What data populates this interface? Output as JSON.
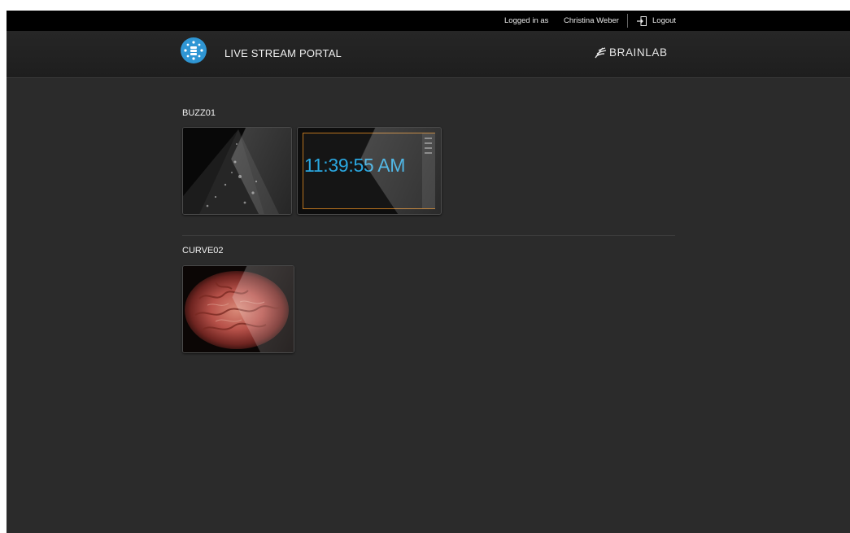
{
  "topbar": {
    "logged_in_label": "Logged in as",
    "user_name": "Christina Weber",
    "logout_label": "Logout",
    "logout_icon": "logout-icon"
  },
  "header": {
    "app_title": "LIVE STREAM PORTAL",
    "logo_icon": "stream-hub-icon",
    "brand_name": "BRAINLAB"
  },
  "colors": {
    "accent_blue": "#2aa7e0",
    "background": "#2b2b2b",
    "topbar": "#000000",
    "orange_frame": "#b9731f"
  },
  "sections": [
    {
      "name": "BUZZ01",
      "streams": [
        {
          "kind": "ultrasound-feed"
        },
        {
          "kind": "clock-feed",
          "clock_text": "11:39:55 AM"
        }
      ]
    },
    {
      "name": "CURVE02",
      "streams": [
        {
          "kind": "microscope-feed"
        }
      ]
    }
  ]
}
